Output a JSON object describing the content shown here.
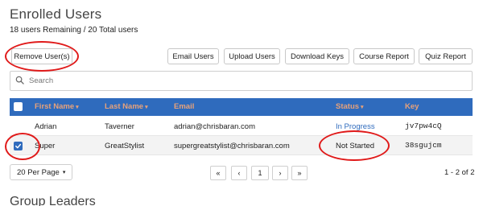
{
  "page": {
    "title": "Enrolled Users",
    "summary": "18 users Remaining / 20 Total users"
  },
  "toolbar": {
    "remove_label": "Remove User(s)",
    "email_label": "Email Users",
    "upload_label": "Upload Users",
    "download_label": "Download Keys",
    "course_report_label": "Course Report",
    "quiz_report_label": "Quiz Report"
  },
  "search": {
    "placeholder": "Search",
    "value": ""
  },
  "table": {
    "columns": {
      "first_name": "First Name",
      "last_name": "Last Name",
      "email": "Email",
      "status": "Status",
      "key": "Key"
    },
    "rows": [
      {
        "checked": false,
        "first_name": "Adrian",
        "last_name": "Taverner",
        "email": "adrian@chrisbaran.com",
        "status": "In Progress",
        "key": "jv7pw4cQ"
      },
      {
        "checked": true,
        "first_name": "Super",
        "last_name": "GreatStylist",
        "email": "supergreatstylist@chrisbaran.com",
        "status": "Not Started",
        "key": "38sgujcm"
      }
    ]
  },
  "pagination": {
    "per_page_label": "20 Per Page",
    "first": "«",
    "prev": "‹",
    "current": "1",
    "next": "›",
    "last": "»",
    "range_label": "1 - 2 of 2"
  },
  "next_section": {
    "title": "Group Leaders"
  },
  "colors": {
    "header_bar": "#2f6bbd",
    "header_text": "#e8a27a",
    "annotation": "#e01a1a",
    "status_link": "#2f6bbd"
  },
  "icons": {
    "search": "search-icon",
    "check": "check-icon",
    "sort": "sort-caret-icon"
  }
}
